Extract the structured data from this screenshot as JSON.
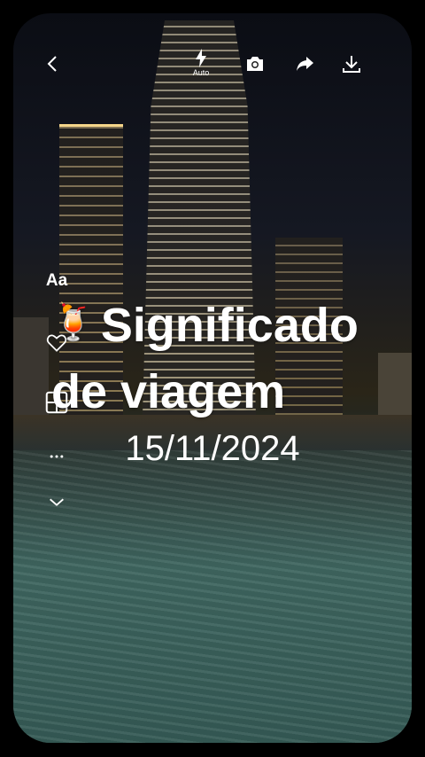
{
  "toolbar": {
    "back_icon": "chevron-left-icon",
    "flash_icon": "flash-icon",
    "flash_label": "Auto",
    "camera_icon": "camera-icon",
    "share_icon": "share-icon",
    "download_icon": "download-icon"
  },
  "side_tools": {
    "text_style_label": "Aa",
    "like_icon": "heart-icon",
    "layout_icon": "layout-icon",
    "more_icon": "more-icon",
    "collapse_icon": "chevron-down-icon"
  },
  "overlay": {
    "emoji": "🍹",
    "title": "Significado de viagem",
    "date": "15/11/2024"
  }
}
